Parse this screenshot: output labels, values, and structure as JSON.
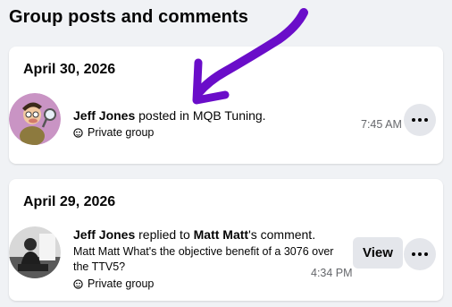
{
  "page": {
    "title": "Group posts and comments"
  },
  "cards": [
    {
      "date": "April 30, 2026",
      "actor": "Jeff Jones",
      "verb": " posted in ",
      "target": "MQB Tuning.",
      "privacy": "Private group",
      "time": "7:45 AM",
      "avatar_icon": "cartoon-detective-avatar",
      "more_icon": "more-options-icon"
    },
    {
      "date": "April 29, 2026",
      "actor": "Jeff Jones",
      "verb": " replied to ",
      "target": "Matt Matt",
      "suffix": "'s comment.",
      "snippet": "Matt Matt What's the objective benefit of a 3076 over the TTV5?",
      "privacy": "Private group",
      "time": "4:34 PM",
      "view_label": "View",
      "avatar_icon": "person-photo-avatar",
      "more_icon": "more-options-icon"
    }
  ],
  "annotation": {
    "color": "#6a0dc9"
  }
}
